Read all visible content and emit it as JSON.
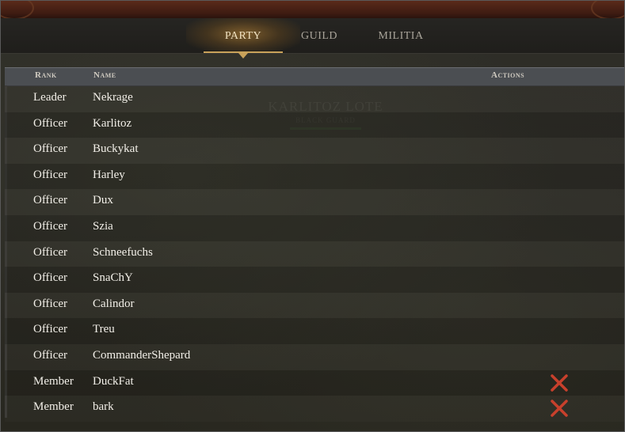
{
  "tabs": [
    {
      "label": "PARTY",
      "active": true
    },
    {
      "label": "GUILD",
      "active": false
    },
    {
      "label": "MILITIA",
      "active": false
    }
  ],
  "watermark": {
    "title": "KARLITOZ LOTE",
    "subtitle": "BLACK GUARD"
  },
  "table": {
    "headers": {
      "rank": "Rank",
      "name": "Name",
      "actions": "Actions"
    },
    "rows": [
      {
        "rank": "Leader",
        "name": "Nekrage",
        "kick": false
      },
      {
        "rank": "Officer",
        "name": "Karlitoz",
        "kick": false
      },
      {
        "rank": "Officer",
        "name": "Buckykat",
        "kick": false
      },
      {
        "rank": "Officer",
        "name": "Harley",
        "kick": false
      },
      {
        "rank": "Officer",
        "name": "Dux",
        "kick": false
      },
      {
        "rank": "Officer",
        "name": "Szia",
        "kick": false
      },
      {
        "rank": "Officer",
        "name": "Schneefuchs",
        "kick": false
      },
      {
        "rank": "Officer",
        "name": "SnaChY",
        "kick": false
      },
      {
        "rank": "Officer",
        "name": "Calindor",
        "kick": false
      },
      {
        "rank": "Officer",
        "name": "Treu",
        "kick": false
      },
      {
        "rank": "Officer",
        "name": "CommanderShepard",
        "kick": false
      },
      {
        "rank": "Member",
        "name": "DuckFat",
        "kick": true
      },
      {
        "rank": "Member",
        "name": "bark",
        "kick": true
      }
    ]
  },
  "colors": {
    "accent_gold": "#c9a25a",
    "kick_red": "#c8402c",
    "header_bg": "#4b4e52"
  },
  "icons": {
    "kick": "close-icon"
  }
}
